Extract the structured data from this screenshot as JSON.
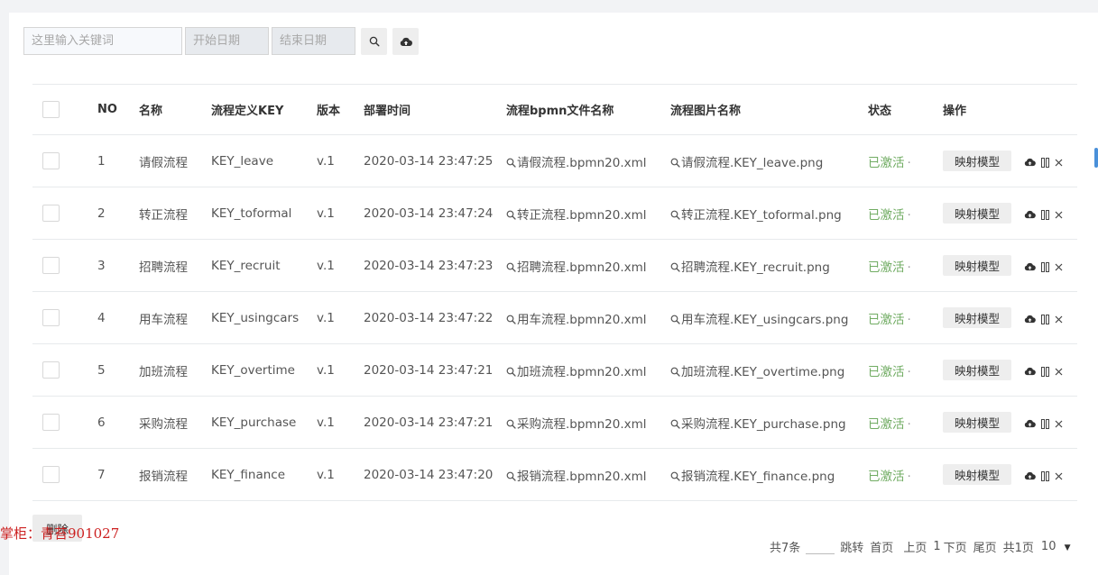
{
  "search": {
    "keyword_placeholder": "这里输入关键词",
    "start_date_placeholder": "开始日期",
    "end_date_placeholder": "结束日期"
  },
  "table": {
    "columns": [
      "NO",
      "名称",
      "流程定义KEY",
      "版本",
      "部署时间",
      "流程bpmn文件名称",
      "流程图片名称",
      "状态",
      "操作"
    ],
    "rows": [
      {
        "no": "1",
        "name": "请假流程",
        "key": "KEY_leave",
        "version": "v.1",
        "time": "2020-03-14 23:47:25",
        "bpmn": "请假流程.bpmn20.xml",
        "image": "请假流程.KEY_leave.png",
        "status": "已激活",
        "status_dot": "·",
        "action": "映射模型"
      },
      {
        "no": "2",
        "name": "转正流程",
        "key": "KEY_toformal",
        "version": "v.1",
        "time": "2020-03-14 23:47:24",
        "bpmn": "转正流程.bpmn20.xml",
        "image": "转正流程.KEY_toformal.png",
        "status": "已激活",
        "status_dot": "·",
        "action": "映射模型"
      },
      {
        "no": "3",
        "name": "招聘流程",
        "key": "KEY_recruit",
        "version": "v.1",
        "time": "2020-03-14 23:47:23",
        "bpmn": "招聘流程.bpmn20.xml",
        "image": "招聘流程.KEY_recruit.png",
        "status": "已激活",
        "status_dot": "·",
        "action": "映射模型"
      },
      {
        "no": "4",
        "name": "用车流程",
        "key": "KEY_usingcars",
        "version": "v.1",
        "time": "2020-03-14 23:47:22",
        "bpmn": "用车流程.bpmn20.xml",
        "image": "用车流程.KEY_usingcars.png",
        "status": "已激活",
        "status_dot": "·",
        "action": "映射模型"
      },
      {
        "no": "5",
        "name": "加班流程",
        "key": "KEY_overtime",
        "version": "v.1",
        "time": "2020-03-14 23:47:21",
        "bpmn": "加班流程.bpmn20.xml",
        "image": "加班流程.KEY_overtime.png",
        "status": "已激活",
        "status_dot": "·",
        "action": "映射模型"
      },
      {
        "no": "6",
        "name": "采购流程",
        "key": "KEY_purchase",
        "version": "v.1",
        "time": "2020-03-14 23:47:21",
        "bpmn": "采购流程.bpmn20.xml",
        "image": "采购流程.KEY_purchase.png",
        "status": "已激活",
        "status_dot": "·",
        "action": "映射模型"
      },
      {
        "no": "7",
        "name": "报销流程",
        "key": "KEY_finance",
        "version": "v.1",
        "time": "2020-03-14 23:47:20",
        "bpmn": "报销流程.bpmn20.xml",
        "image": "报销流程.KEY_finance.png",
        "status": "已激活",
        "status_dot": "·",
        "action": "映射模型"
      }
    ]
  },
  "footer": {
    "delete_label": "删除",
    "watermark": "掌柜：青苔901027"
  },
  "pager": {
    "total": "共7条",
    "jump": "跳转",
    "first": "首页",
    "prev": "上页",
    "current": "1",
    "next": "下页",
    "last": "尾页",
    "pages": "共1页",
    "page_size": "10",
    "page_size_caret": "▼"
  },
  "colors": {
    "status_active": "#71ac63",
    "accent": "#4a90d9"
  },
  "icons": {
    "search_button": "search-icon",
    "upload_button": "cloud-upload-icon",
    "bpmn_link": "search-icon",
    "row_actions": [
      "cloud-upload-icon",
      "pause-icon",
      "close-icon"
    ]
  }
}
